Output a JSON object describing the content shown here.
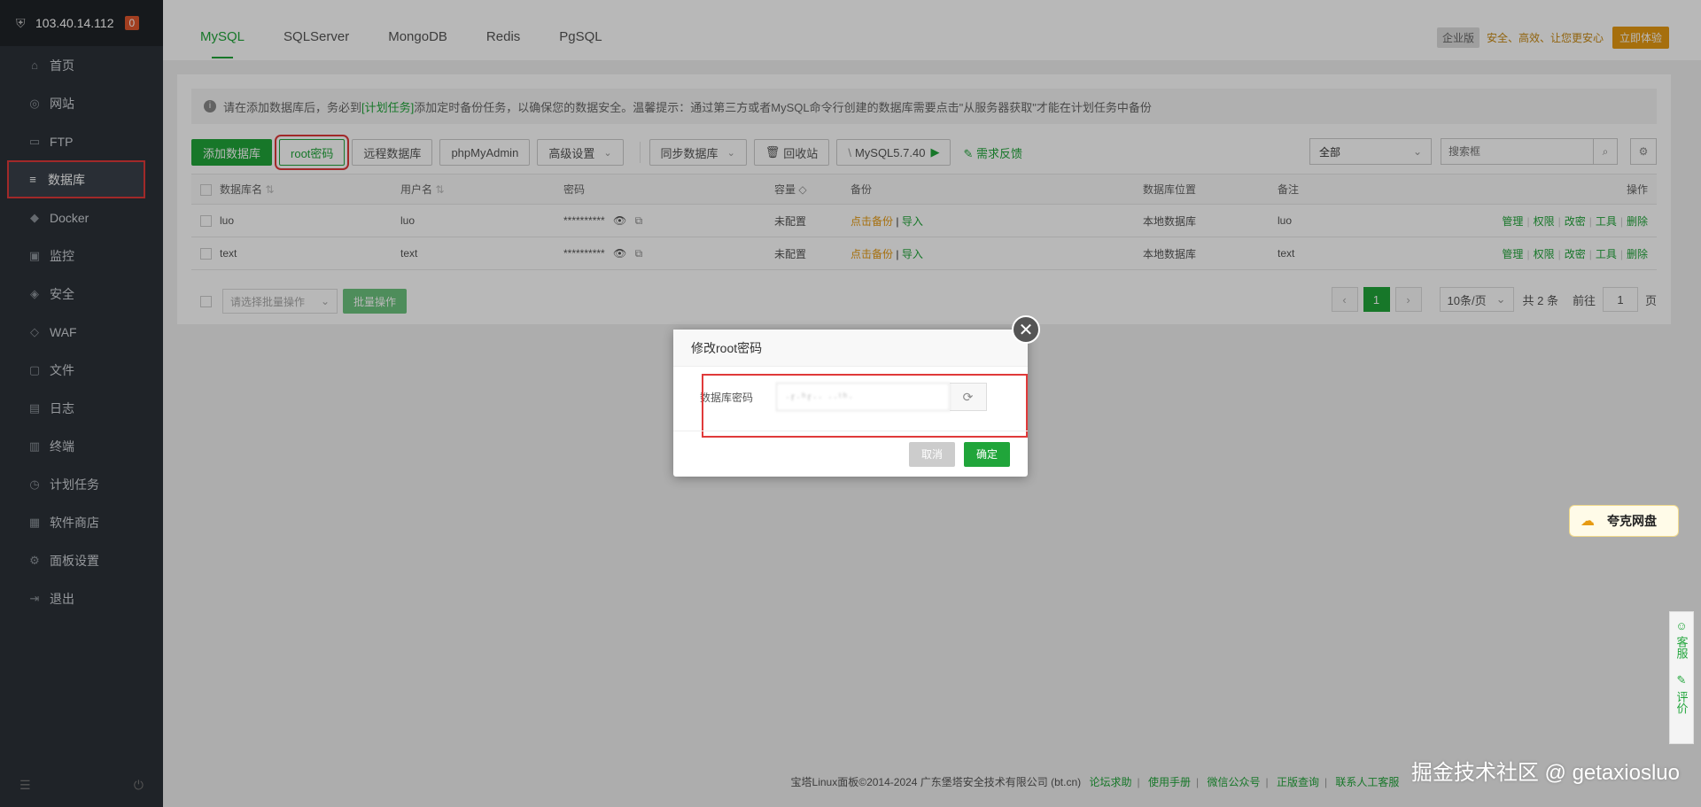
{
  "sidebar": {
    "host": "103.40.14.112",
    "badge": "0",
    "items": [
      {
        "label": "首页",
        "icon": "home-icon"
      },
      {
        "label": "网站",
        "icon": "globe-icon"
      },
      {
        "label": "FTP",
        "icon": "ftp-icon"
      },
      {
        "label": "数据库",
        "icon": "database-icon"
      },
      {
        "label": "Docker",
        "icon": "docker-icon"
      },
      {
        "label": "监控",
        "icon": "monitor-icon"
      },
      {
        "label": "安全",
        "icon": "shield-icon"
      },
      {
        "label": "WAF",
        "icon": "waf-icon"
      },
      {
        "label": "文件",
        "icon": "folder-icon"
      },
      {
        "label": "日志",
        "icon": "log-icon"
      },
      {
        "label": "终端",
        "icon": "terminal-icon"
      },
      {
        "label": "计划任务",
        "icon": "clock-icon"
      },
      {
        "label": "软件商店",
        "icon": "store-icon"
      },
      {
        "label": "面板设置",
        "icon": "settings-icon"
      },
      {
        "label": "退出",
        "icon": "logout-icon"
      }
    ]
  },
  "tabs": [
    "MySQL",
    "SQLServer",
    "MongoDB",
    "Redis",
    "PgSQL"
  ],
  "promo": {
    "tag": "企业版",
    "slogan": "安全、高效、让您更安心",
    "try": "立即体验"
  },
  "notice": {
    "prefix": "请在添加数据库后，务必到",
    "link": "[计划任务]",
    "suffix": "添加定时备份任务，以确保您的数据安全。温馨提示：通过第三方或者MySQL命令行创建的数据库需要点击\"从服务器获取\"才能在计划任务中备份"
  },
  "toolbar": {
    "add_db": "添加数据库",
    "root_pwd": "root密码",
    "remote_db": "远程数据库",
    "phpmyadmin": "phpMyAdmin",
    "advanced": "高级设置",
    "sync": "同步数据库",
    "recycle": "回收站",
    "mysql_ver": "MySQL5.7.40",
    "feedback": "需求反馈",
    "filter": "全部",
    "search_placeholder": "搜索框"
  },
  "table": {
    "headers": [
      "数据库名",
      "用户名",
      "密码",
      "容量",
      "备份",
      "数据库位置",
      "备注",
      "操作"
    ],
    "rows": [
      {
        "name": "luo",
        "user": "luo",
        "pwd": "**********",
        "capacity": "未配置",
        "backup": "点击备份",
        "import": "导入",
        "location": "本地数据库",
        "note": "luo"
      },
      {
        "name": "text",
        "user": "text",
        "pwd": "**********",
        "capacity": "未配置",
        "backup": "点击备份",
        "import": "导入",
        "location": "本地数据库",
        "note": "text"
      }
    ],
    "ops": [
      "管理",
      "权限",
      "改密",
      "工具",
      "删除"
    ]
  },
  "footer_bar": {
    "batch_placeholder": "请选择批量操作",
    "batch_btn": "批量操作",
    "page": "1",
    "per_page": "10条/页",
    "total": "共 2 条",
    "goto_label": "前往",
    "goto_value": "1",
    "page_unit": "页"
  },
  "modal": {
    "title": "修改root密码",
    "field_label": "数据库密码",
    "pwd_value": "·r·ʰr·· ··ᵗʰ·",
    "cancel": "取消",
    "ok": "确定"
  },
  "quark": {
    "label": "夸克网盘"
  },
  "service": {
    "kefu": "客服",
    "pingjia": "评价"
  },
  "copyright": {
    "text": "宝塔Linux面板©2014-2024 广东堡塔安全技术有限公司 (bt.cn)",
    "links": [
      "论坛求助",
      "使用手册",
      "微信公众号",
      "正版查询",
      "联系人工客服"
    ]
  },
  "watermark": "掘金技术社区 @ getaxiosluo"
}
